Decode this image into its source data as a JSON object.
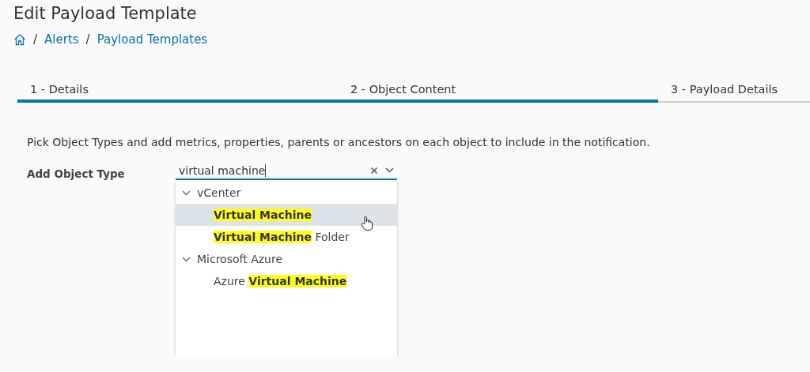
{
  "page": {
    "title": "Edit Payload Template"
  },
  "breadcrumb": [
    {
      "separator": "/",
      "label": "Alerts"
    },
    {
      "separator": "/",
      "label": "Payload Templates"
    }
  ],
  "steps": [
    {
      "label": "1 - Details",
      "active": true
    },
    {
      "label": "2 - Object Content",
      "active": true
    },
    {
      "label": "3 - Payload Details",
      "active": false
    }
  ],
  "description": "Pick Object Types and add metrics, properties, parents or ancestors on each object to include in the notification.",
  "object_type": {
    "label": "Add Object Type",
    "value": "virtual machine",
    "groups": [
      {
        "label": "vCenter",
        "expanded": true,
        "children": [
          {
            "label": "**Virtual Machine**",
            "hovered": true
          },
          {
            "label": "**Virtual Machine** Folder",
            "hovered": false
          }
        ]
      },
      {
        "label": "Microsoft Azure",
        "expanded": true,
        "children": [
          {
            "label": "Azure **Virtual Machine**",
            "hovered": false
          }
        ]
      }
    ]
  }
}
